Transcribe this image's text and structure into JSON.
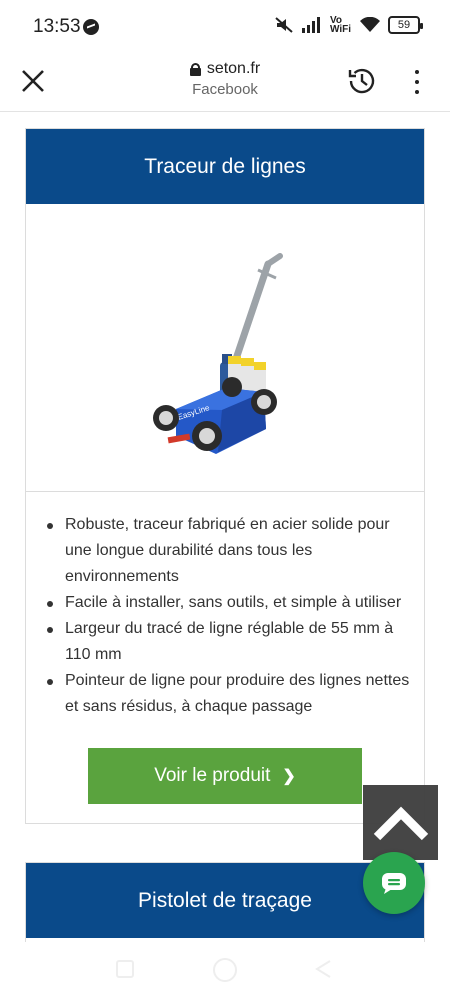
{
  "status_bar": {
    "time": "13:53",
    "network_label_top": "Vo",
    "network_label_bottom": "WiFi",
    "battery": "59"
  },
  "browser": {
    "domain": "seton.fr",
    "source": "Facebook"
  },
  "product_card": {
    "title": "Traceur de lignes",
    "features": [
      "Robuste, traceur fabriqué en acier solide pour une longue durabilité dans tous les environnements",
      "Facile à installer, sans outils, et simple à utiliser",
      "Largeur du tracé de ligne réglable de 55 mm à 110 mm",
      "Pointeur de ligne pour produire des lignes nettes et sans résidus, à chaque passage"
    ],
    "cta_label": "Voir le produit",
    "cta_chevron": "❯",
    "image_brand_text": "EasyLine"
  },
  "next_card": {
    "title": "Pistolet de traçage"
  },
  "colors": {
    "header_blue": "#0a4a8a",
    "cta_green": "#5aa33e",
    "chat_green": "#2aa44f"
  }
}
